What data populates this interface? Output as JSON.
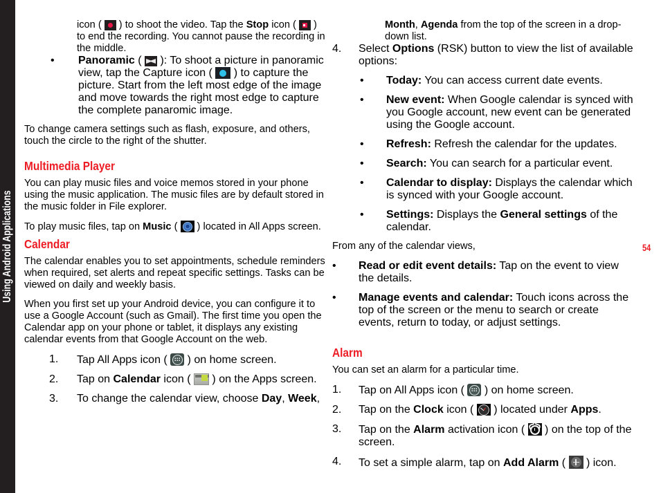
{
  "sidebar": {
    "tab_label": "Using Android Applications"
  },
  "page_number": "54",
  "colors": {
    "heading_red": "#ED1C24",
    "sidebar_black": "#231f20",
    "record_red": "#E8174A",
    "capture_cyan": "#2FC0E8",
    "calendar_green": "#c4d93f"
  },
  "left_column": {
    "video_continuation": {
      "part1": "icon ( ",
      "icon1": "record-icon",
      "part2": " ) to shoot the video. Tap the ",
      "bold1": "Stop",
      "part3": " icon ( ",
      "icon2": "stop-icon",
      "part4": " ) to end the recording. You cannot pause the recording in the middle."
    },
    "panoramic_bullet": {
      "marker": "•",
      "bold1": "Panoramic",
      "part1": " ( ",
      "icon1": "panoramic-icon",
      "part2": " ): To shoot a picture in panoramic view, tap the Capture icon ( ",
      "icon2": "capture-icon",
      "part3": " ) to capture the picture. Start from the left most edge of the image and move towards the right most edge to capture the complete panaromic image."
    },
    "camera_settings_para": "To change camera settings such as flash, exposure, and others, touch the circle to the right of the shutter.",
    "multimedia_heading": "Multimedia Player",
    "multimedia_para1": "You can play music files and voice memos stored in your phone using the music application. The music files are by default stored in the music folder in File explorer.",
    "multimedia_para2": {
      "part1": "To play music files, tap on ",
      "bold1": "Music",
      "part2": " ( ",
      "icon1": "music-icon",
      "part3": " ) located in All Apps screen."
    },
    "calendar_heading": "Calendar",
    "calendar_para1": "The calendar enables you to set appointments, schedule reminders when required, set alerts and repeat specific settings. Tasks can be viewed on daily and weekly basis.",
    "calendar_para2": "When you first set up your Android device, you can configure it to use a Google Account (such as Gmail). The first time you open the Calendar app on your phone or tablet, it displays any existing calendar events from that Google Account on the web.",
    "calendar_steps": [
      {
        "number": "1.",
        "part1": "Tap All Apps icon ( ",
        "icon1": "all-apps-icon",
        "part2": " ) on home screen."
      },
      {
        "number": "2.",
        "part1": "Tap on ",
        "bold1": "Calendar",
        "part2": " icon ( ",
        "icon1": "calendar-icon",
        "part3": " ) on the Apps screen."
      },
      {
        "number": "3.",
        "part1": "To change the calendar view, choose ",
        "bold1": "Day",
        "part2": ", ",
        "bold2": "Week",
        "part3": ","
      }
    ]
  },
  "right_column": {
    "step3_continuation": {
      "bold1": "Month",
      "part1": ", ",
      "bold2": "Agenda",
      "part2": " from the top of the screen in a drop-down list."
    },
    "step4": {
      "number": "4.",
      "part1": "Select ",
      "bold1": "Options",
      "part2": " (RSK) button to view the list of available options:"
    },
    "option_bullets": [
      {
        "marker": "•",
        "bold": "Today:",
        "text": " You can access current date events."
      },
      {
        "marker": "•",
        "bold": "New event:",
        "text": " When Google calendar is synced with you Google account, new event can be generated using the Google account."
      },
      {
        "marker": "•",
        "bold": "Refresh:",
        "text": " Refresh the calendar for the updates."
      },
      {
        "marker": "•",
        "bold": "Search:",
        "text": " You can search for a particular event."
      },
      {
        "marker": "•",
        "bold": "Calendar to display:",
        "text": " Displays the calendar which is synced with your Google account."
      },
      {
        "marker": "•",
        "bold": "Settings:",
        "text": " Displays the ",
        "bold2": "General settings",
        "text2": " of the calendar."
      }
    ],
    "from_views_para": "From any of the calendar views,",
    "view_bullets": [
      {
        "marker": "•",
        "bold": "Read or edit event details:",
        "text": " Tap on the event to view the details."
      },
      {
        "marker": "•",
        "bold": "Manage events and calendar:",
        "text": " Touch icons across the top of the screen or the menu to search or create events, return to today, or adjust settings."
      }
    ],
    "alarm_heading": "Alarm",
    "alarm_intro": "You can set an alarm for a particular time.",
    "alarm_steps": [
      {
        "number": "1.",
        "part1": "Tap on All Apps icon ( ",
        "icon1": "all-apps-icon",
        "part2": " ) on home screen."
      },
      {
        "number": "2.",
        "part1": "Tap on the ",
        "bold1": "Clock",
        "part2": " icon ( ",
        "icon1": "clock-icon",
        "part3": " ) located under ",
        "bold2": "Apps",
        "part4": "."
      },
      {
        "number": "3.",
        "part1": "Tap on the ",
        "bold1": "Alarm",
        "part2": " activation icon ( ",
        "icon1": "alarm-icon",
        "part3": " ) on the top of the screen."
      },
      {
        "number": "4.",
        "part1": "To set a simple alarm, tap on ",
        "bold1": "Add Alarm",
        "part2": " ( ",
        "icon1": "add-alarm-icon",
        "part3": " ) icon."
      }
    ]
  }
}
